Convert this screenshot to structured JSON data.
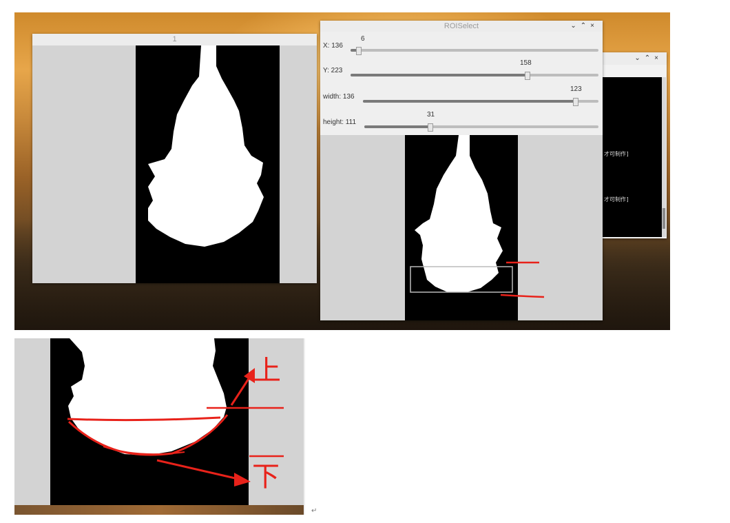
{
  "image_window": {
    "title": "1"
  },
  "roi_window": {
    "title": "ROISelect",
    "controls": [
      "⌄",
      "⌃",
      "×"
    ],
    "sliders": [
      {
        "label": "X: 136",
        "value": "6",
        "fraction": 0.03
      },
      {
        "label": "Y: 223",
        "value": "158",
        "fraction": 0.71
      },
      {
        "label": "width: 136",
        "value": "123",
        "fraction": 0.9
      },
      {
        "label": "height: 111",
        "value": "31",
        "fraction": 0.28
      }
    ]
  },
  "terminal_window": {
    "controls": [
      "⌄",
      "⌃",
      "×"
    ],
    "lines": [
      "才可制作]",
      "才可制作]"
    ]
  },
  "annotations": {
    "upper": "上",
    "lower": "下"
  },
  "return_mark": "↵"
}
